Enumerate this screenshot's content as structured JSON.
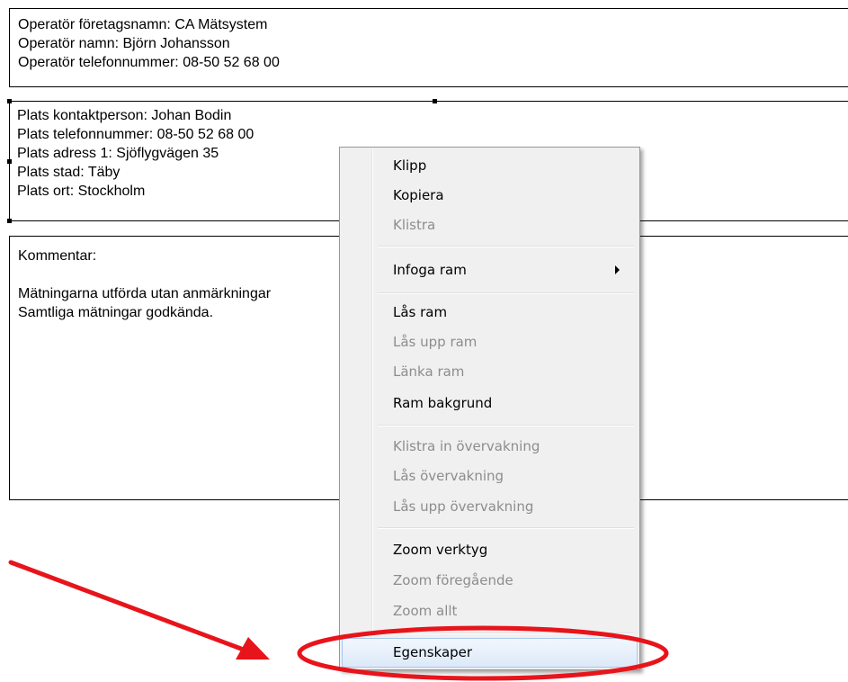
{
  "operator_frame": {
    "company": "Operatör företagsnamn: CA Mätsystem",
    "name": "Operatör namn: Björn Johansson",
    "phone": "Operatör telefonnummer: 08-50 52 68 00"
  },
  "site_frame": {
    "contact": "Plats kontaktperson: Johan Bodin",
    "phone": "Plats telefonnummer: 08-50 52 68 00",
    "address": "Plats adress 1: Sjöflygvägen 35",
    "city": "Plats stad: Täby",
    "region": "Plats ort: Stockholm"
  },
  "comment_frame": {
    "label": "Kommentar:",
    "line1": "Mätningarna utförda utan anmärkningar",
    "line2": "Samtliga mätningar godkända."
  },
  "context_menu": {
    "items": [
      {
        "label": "Klipp",
        "enabled": true
      },
      {
        "label": "Kopiera",
        "enabled": true
      },
      {
        "label": "Klistra",
        "enabled": false
      },
      {
        "label": "Infoga ram",
        "enabled": true,
        "submenu": true
      },
      {
        "label": "Lås ram",
        "enabled": true
      },
      {
        "label": "Lås upp ram",
        "enabled": false
      },
      {
        "label": "Länka ram",
        "enabled": false
      },
      {
        "label": "Ram bakgrund",
        "enabled": true
      },
      {
        "label": "Klistra in övervakning",
        "enabled": false
      },
      {
        "label": "Lås övervakning",
        "enabled": false
      },
      {
        "label": "Lås upp övervakning",
        "enabled": false
      },
      {
        "label": "Zoom verktyg",
        "enabled": true
      },
      {
        "label": "Zoom föregående",
        "enabled": false
      },
      {
        "label": "Zoom allt",
        "enabled": false
      },
      {
        "label": "Egenskaper",
        "enabled": true,
        "highlighted": true
      }
    ]
  },
  "annotation": {
    "color": "#e8141b",
    "shapes": [
      "arrow",
      "ellipse"
    ]
  },
  "colors": {
    "menu_background": "#f0f0f0",
    "disabled_text": "#8d8d8d",
    "highlight_border": "#a8c6ef"
  }
}
